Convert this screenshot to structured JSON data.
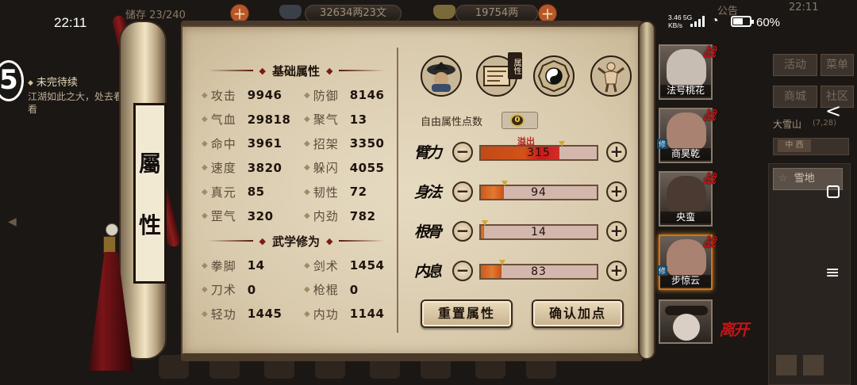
{
  "status_bar": {
    "time": "22:11",
    "speed_value": "3.46",
    "speed_net": "5G",
    "speed_unit": "KB/s",
    "battery": "60%"
  },
  "hud": {
    "storage": "储存 23/240",
    "money": "32634两23文",
    "gold": "19754两",
    "notice": "公告",
    "clock": "22:11"
  },
  "quest": {
    "badge": "5",
    "title": "未完待续",
    "text": "江湖如此之大，处去看看"
  },
  "right_menu": {
    "activity": "活动",
    "menu": "菜单",
    "shop": "商城",
    "community": "社区",
    "location": "大雪山",
    "location_time": "(7,28)",
    "tab_active": "中 西",
    "terrain": "雪地"
  },
  "scroll_title": {
    "char1": "屬",
    "char2": "性"
  },
  "sections": {
    "base": "基础属性",
    "martial": "武学修为"
  },
  "base_stats": [
    {
      "label": "攻击",
      "value": "9946"
    },
    {
      "label": "防御",
      "value": "8146"
    },
    {
      "label": "气血",
      "value": "29818"
    },
    {
      "label": "聚气",
      "value": "13"
    },
    {
      "label": "命中",
      "value": "3961"
    },
    {
      "label": "招架",
      "value": "3350"
    },
    {
      "label": "速度",
      "value": "3820"
    },
    {
      "label": "躲闪",
      "value": "4055"
    },
    {
      "label": "真元",
      "value": "85"
    },
    {
      "label": "韧性",
      "value": "72"
    },
    {
      "label": "罡气",
      "value": "320"
    },
    {
      "label": "内劲",
      "value": "782"
    }
  ],
  "martial_stats": [
    {
      "label": "拳脚",
      "value": "14"
    },
    {
      "label": "剑术",
      "value": "1454"
    },
    {
      "label": "刀术",
      "value": "0"
    },
    {
      "label": "枪棍",
      "value": "0"
    },
    {
      "label": "轻功",
      "value": "1445"
    },
    {
      "label": "内功",
      "value": "1144"
    }
  ],
  "tabs": {
    "attr_tag": "属性",
    "icons": [
      "character-hat-icon",
      "scroll-map-icon",
      "taiji-icon",
      "muscle-figure-icon"
    ]
  },
  "free_points": {
    "label": "自由属性点数",
    "value": "0"
  },
  "attributes": [
    {
      "name": "臂力",
      "value": "315",
      "fill": 0.68,
      "overflow": true
    },
    {
      "name": "身法",
      "value": "94",
      "fill": 0.2,
      "overflow": false
    },
    {
      "name": "根骨",
      "value": "14",
      "fill": 0.03,
      "overflow": false
    },
    {
      "name": "内息",
      "value": "83",
      "fill": 0.18,
      "overflow": false
    }
  ],
  "overflow_label": "溢出",
  "buttons": {
    "reset": "重置属性",
    "confirm": "确认加点",
    "leave": "离开"
  },
  "characters": [
    {
      "name": "法号桃花",
      "war": "战",
      "cultivate": ""
    },
    {
      "name": "商昊乾",
      "war": "战",
      "cultivate": "修"
    },
    {
      "name": "央蛮",
      "war": "战",
      "cultivate": ""
    },
    {
      "name": "步惊云",
      "war": "战",
      "cultivate": "修"
    }
  ],
  "colors": {
    "parchment": "#ded1b6",
    "bar_fill": "#e27a30",
    "bar_overflow": "#c8181b",
    "war_red": "#c31414"
  }
}
